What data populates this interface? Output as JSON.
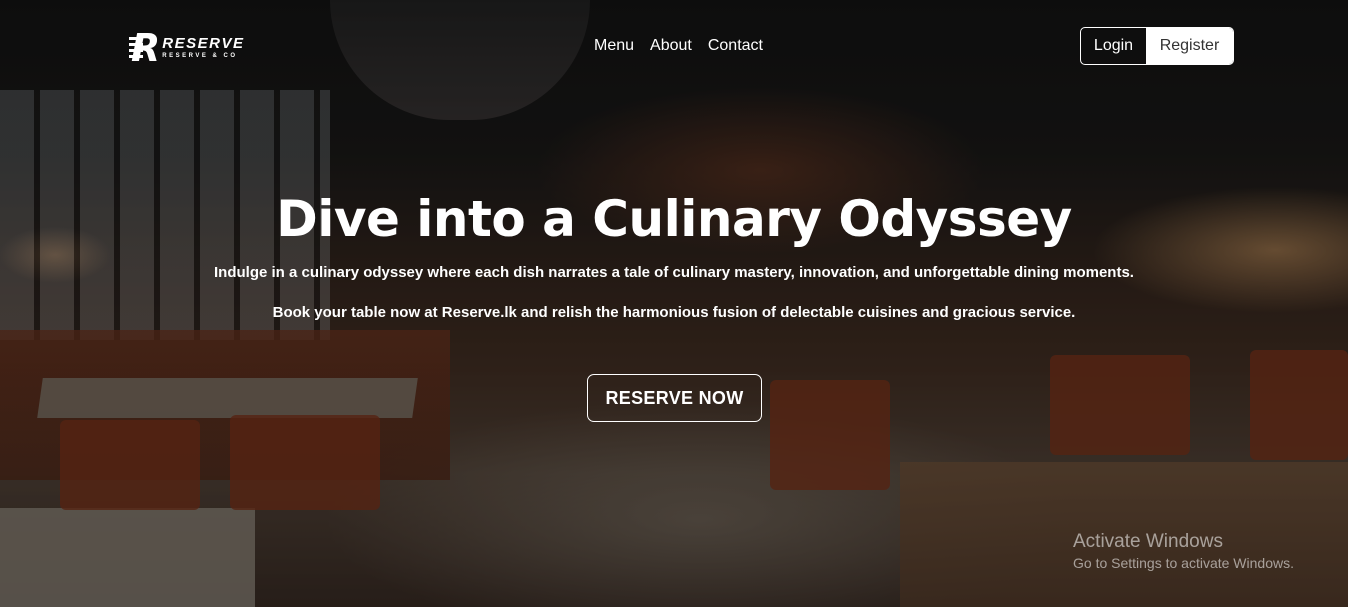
{
  "brand": {
    "logo_letter": "R",
    "logo_title": "RESERVE",
    "logo_subtitle": "RESERVE & CO"
  },
  "nav": {
    "items": [
      "Menu",
      "About",
      "Contact"
    ]
  },
  "auth": {
    "login_label": "Login",
    "register_label": "Register"
  },
  "hero": {
    "title": "Dive into a Culinary Odyssey",
    "line1": "Indulge in a culinary odyssey where each dish narrates a tale of culinary mastery, innovation, and unforgettable dining moments.",
    "line2": "Book your table now at Reserve.lk and relish the harmonious fusion of delectable cuisines and gracious service.",
    "cta_label": "RESERVE NOW"
  },
  "os_watermark": {
    "title": "Activate Windows",
    "subtitle": "Go to Settings to activate Windows."
  }
}
